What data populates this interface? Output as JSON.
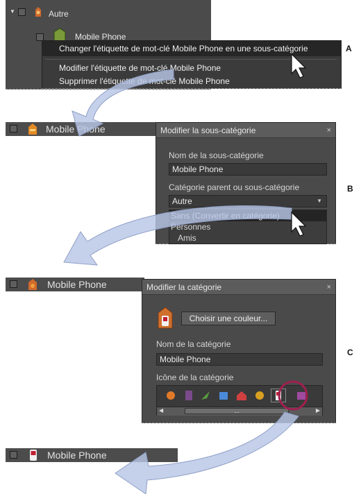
{
  "callouts": {
    "a": "A",
    "b": "B",
    "c": "C"
  },
  "step_a": {
    "tree_parent": "Autre",
    "tree_child": "Mobile Phone",
    "menu": [
      "Changer l'étiquette de mot-clé Mobile Phone en une sous-catégorie",
      "Modifier l'étiquette de mot-clé Mobile Phone",
      "Supprimer l'étiquette de mot-clé Mobile Phone"
    ]
  },
  "step_b": {
    "tag_label": "Mobile Phone",
    "dialog_title": "Modifier la sous-catégorie",
    "close": "×",
    "name_label": "Nom de la sous-catégorie",
    "name_value": "Mobile Phone",
    "parent_label": "Catégorie parent ou sous-catégorie",
    "parent_value": "Autre",
    "options": [
      "Sans (Convertir en catégorie)",
      "Personnes",
      "Amis"
    ]
  },
  "step_c": {
    "tag_label": "Mobile Phone",
    "dialog_title": "Modifier la catégorie",
    "close": "×",
    "color_button": "Choisir une couleur...",
    "name_label": "Nom de la catégorie",
    "name_value": "Mobile Phone",
    "icon_label": "Icône de la catégorie",
    "scroll_grip": "..."
  },
  "step_d": {
    "tag_label": "Mobile Phone"
  },
  "colors": {
    "panel": "#4a4a4a",
    "menu": "#3b3b3b",
    "highlight": "#262626",
    "arrow": "#b8c6e6",
    "ring": "#a0204f"
  }
}
